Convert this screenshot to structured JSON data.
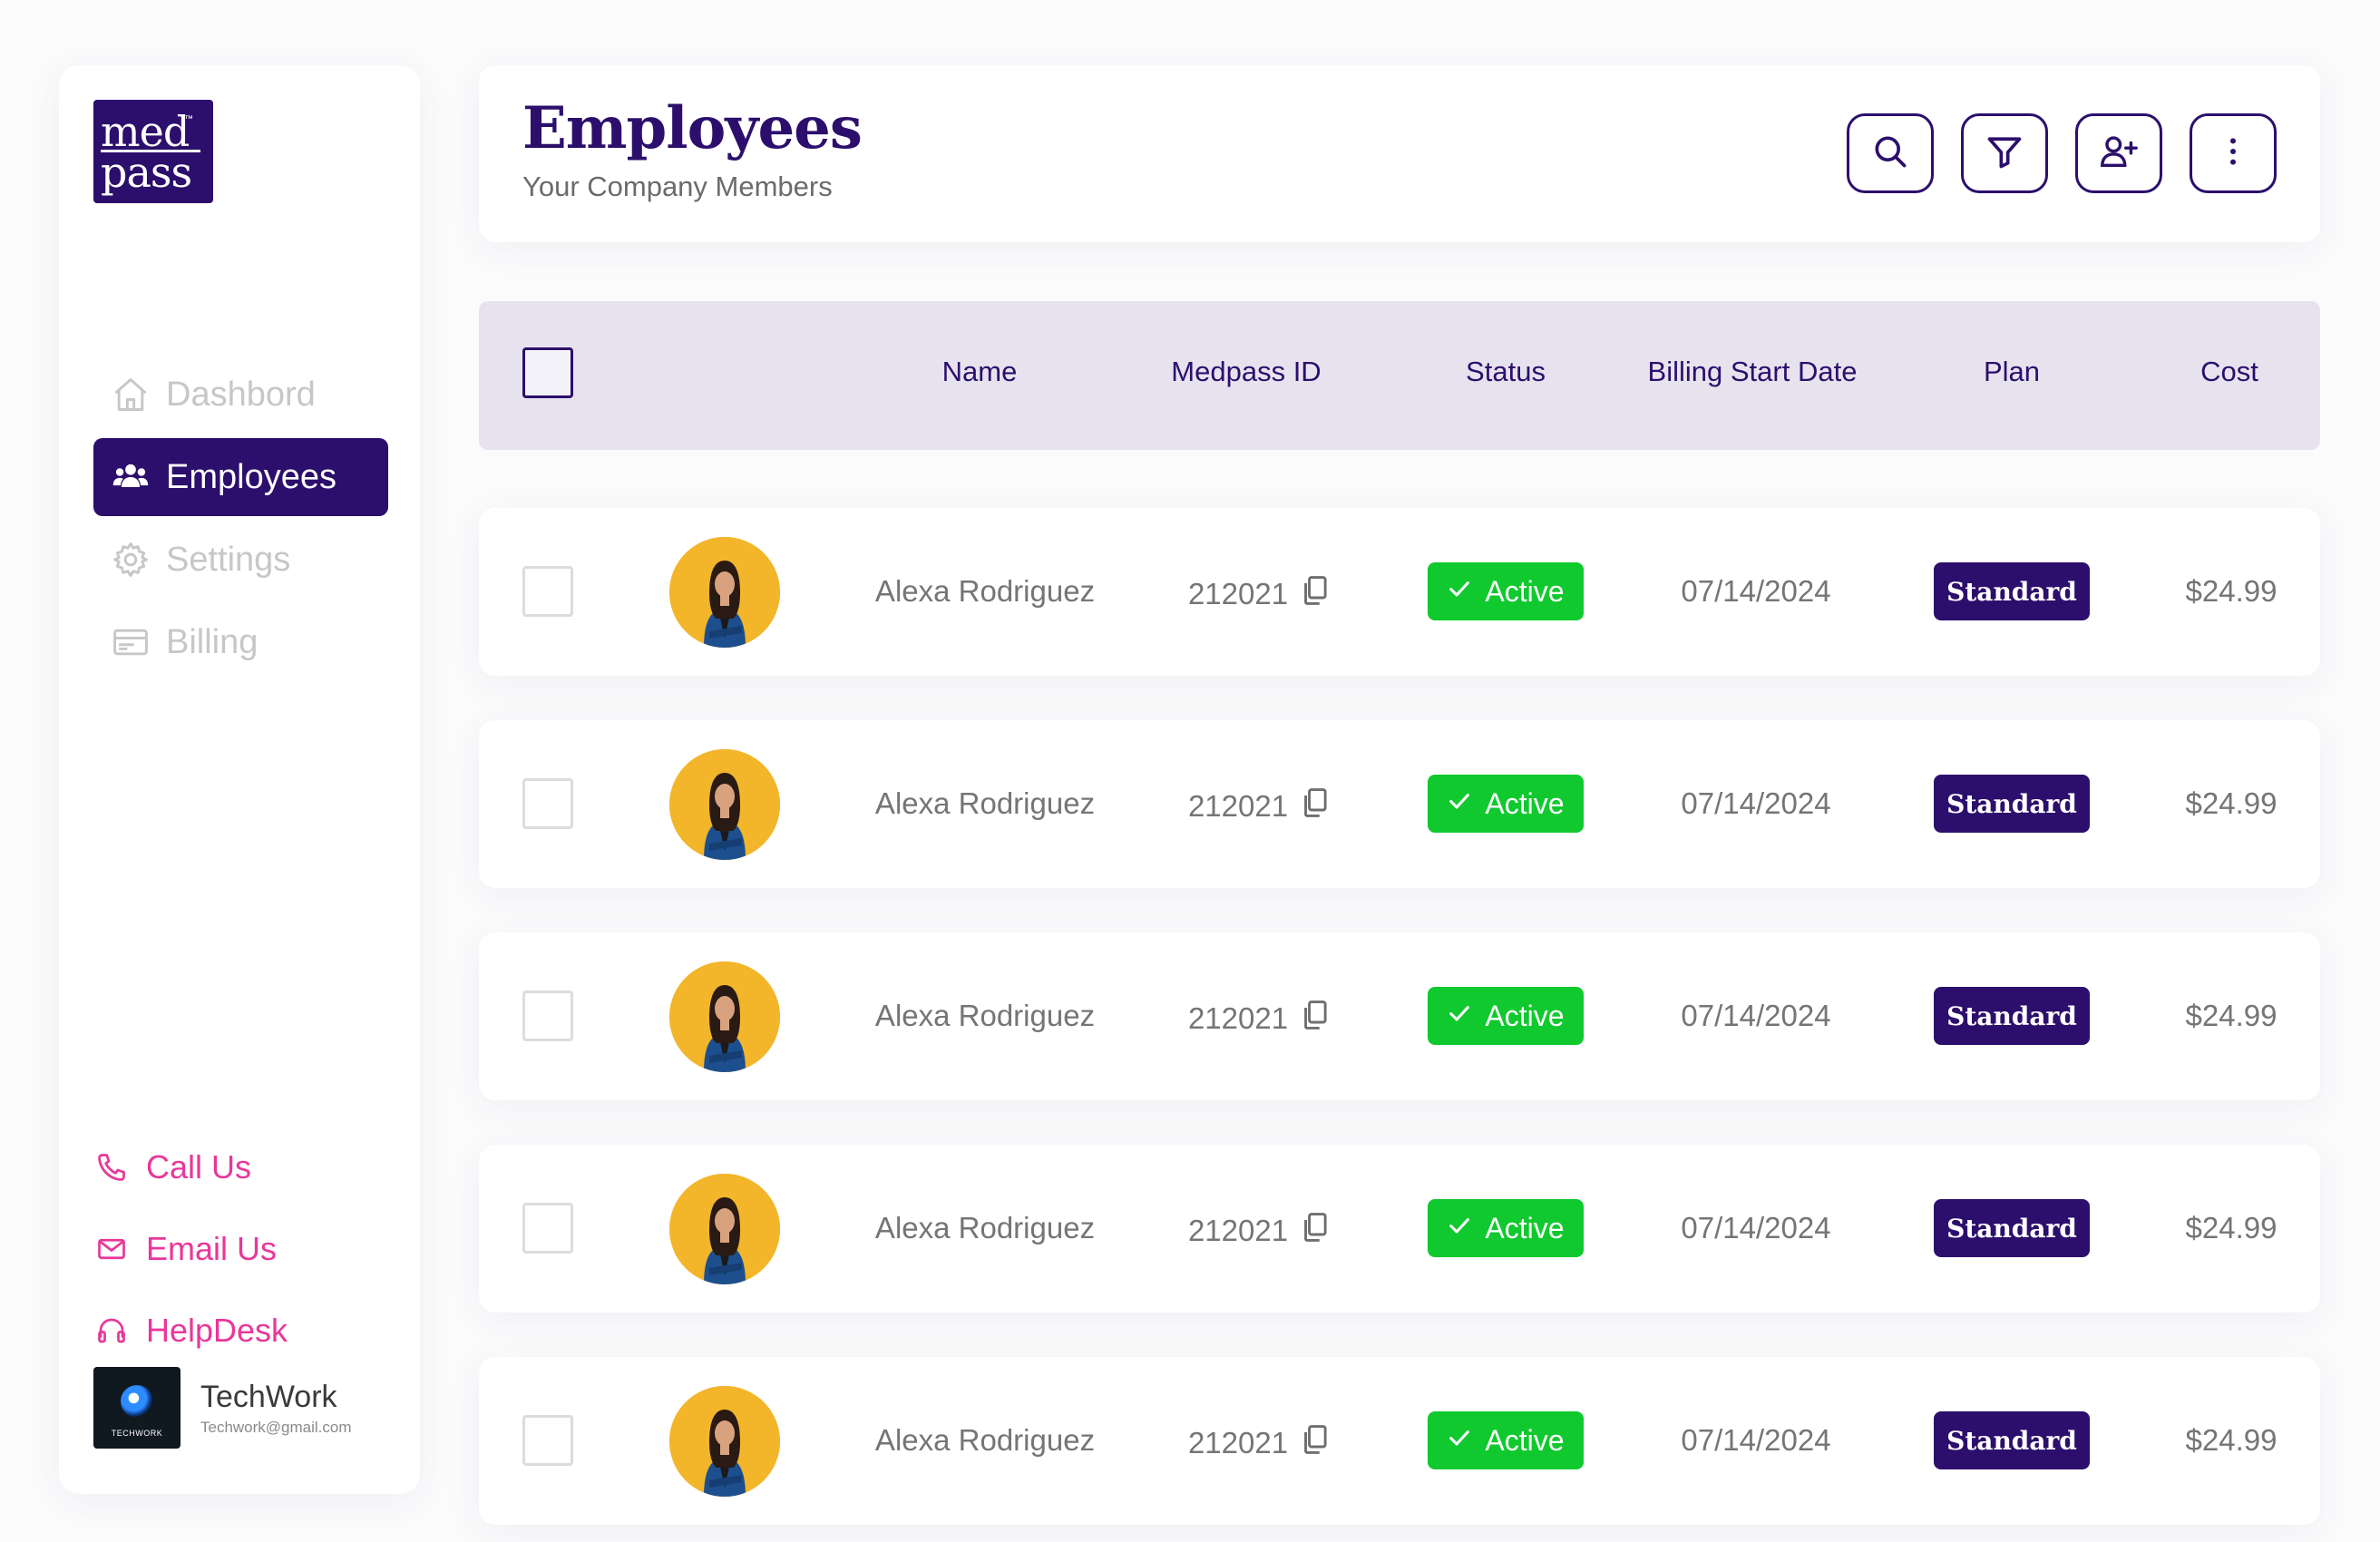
{
  "brand": {
    "logo_line1": "med",
    "logo_line2": "pass",
    "logo_mark": "™"
  },
  "sidebar": {
    "nav": [
      {
        "label": "Dashbord",
        "icon": "home-icon",
        "active": false
      },
      {
        "label": "Employees",
        "icon": "users-icon",
        "active": true
      },
      {
        "label": "Settings",
        "icon": "gear-icon",
        "active": false
      },
      {
        "label": "Billing",
        "icon": "card-icon",
        "active": false
      }
    ],
    "contact": [
      {
        "label": "Call Us",
        "icon": "phone-icon"
      },
      {
        "label": "Email Us",
        "icon": "mail-icon"
      },
      {
        "label": "HelpDesk",
        "icon": "headset-icon"
      }
    ],
    "account": {
      "company_logo_text": "TECHWORK",
      "name": "TechWork",
      "email": "Techwork@gmail.com"
    }
  },
  "header": {
    "title": "Employees",
    "subtitle": "Your Company Members",
    "actions": [
      "search-icon",
      "filter-icon",
      "add-user-icon",
      "more-icon"
    ]
  },
  "table": {
    "columns": [
      "Name",
      "Medpass ID",
      "Status",
      "Billing Start Date",
      "Plan",
      "Cost"
    ],
    "rows": [
      {
        "name": "Alexa Rodriguez",
        "medpass_id": "212021",
        "status": "Active",
        "billing_start": "07/14/2024",
        "plan": "Standard",
        "cost": "$24.99"
      },
      {
        "name": "Alexa Rodriguez",
        "medpass_id": "212021",
        "status": "Active",
        "billing_start": "07/14/2024",
        "plan": "Standard",
        "cost": "$24.99"
      },
      {
        "name": "Alexa Rodriguez",
        "medpass_id": "212021",
        "status": "Active",
        "billing_start": "07/14/2024",
        "plan": "Standard",
        "cost": "$24.99"
      },
      {
        "name": "Alexa Rodriguez",
        "medpass_id": "212021",
        "status": "Active",
        "billing_start": "07/14/2024",
        "plan": "Standard",
        "cost": "$24.99"
      },
      {
        "name": "Alexa Rodriguez",
        "medpass_id": "212021",
        "status": "Active",
        "billing_start": "07/14/2024",
        "plan": "Standard",
        "cost": "$24.99"
      }
    ]
  },
  "colors": {
    "brand_purple": "#2c0f6c",
    "active_green": "#10c92e",
    "contact_pink": "#e9379a",
    "header_bg": "#e6e3ef"
  }
}
